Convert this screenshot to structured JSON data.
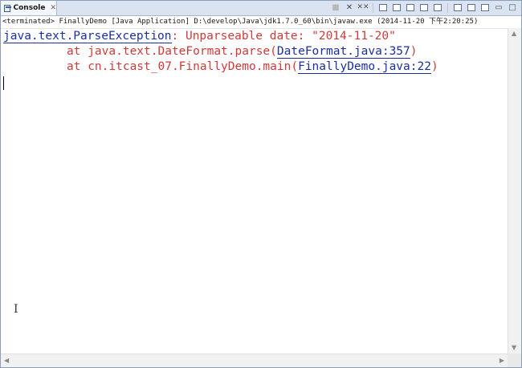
{
  "tab": {
    "label": "Console",
    "close_glyph": "✕"
  },
  "toolbar": {
    "terminate": "■",
    "remove_launch": "✕",
    "remove_all": "✕✕",
    "icons": [
      "terminate-icon",
      "remove-launch-icon",
      "remove-all-terminated-icon",
      "clear-console-icon",
      "scroll-lock-icon",
      "word-wrap-icon",
      "show-on-stdout-icon",
      "show-on-stderr-icon",
      "pin-console-icon",
      "display-selected-console-icon",
      "open-console-icon",
      "minimize-icon",
      "maximize-icon"
    ]
  },
  "status_line": "<terminated> FinallyDemo [Java Application] D:\\develop\\Java\\jdk1.7.0_60\\bin\\javaw.exe (2014-11-20 下午2:20:25)",
  "console": {
    "line1": {
      "exception_link": "java.text.ParseException",
      "message": ": Unparseable date: \"2014-11-20\""
    },
    "line2": {
      "prefix": "at java.text.DateFormat.parse(",
      "link": "DateFormat.java:357",
      "suffix": ")"
    },
    "line3": {
      "prefix": "at cn.itcast_07.FinallyDemo.main(",
      "link": "FinallyDemo.java:22",
      "suffix": ")"
    }
  },
  "colors": {
    "error_text": "#d03a3a",
    "link": "#1b2fa5",
    "tab_bar": "#d9e3f2"
  }
}
